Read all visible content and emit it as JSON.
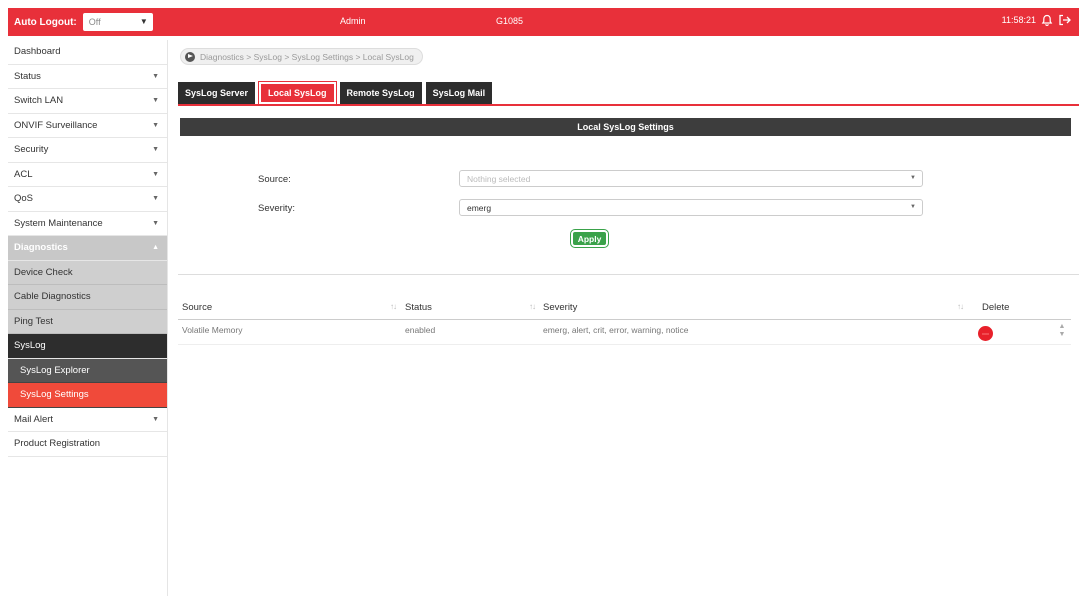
{
  "topbar": {
    "autologout_label": "Auto Logout:",
    "autologout_value": "Off",
    "user": "Admin",
    "model": "G1085",
    "time": "11:58:21"
  },
  "sidebar": {
    "items": [
      {
        "label": "Dashboard"
      },
      {
        "label": "Status"
      },
      {
        "label": "Switch LAN"
      },
      {
        "label": "ONVIF Surveillance"
      },
      {
        "label": "Security"
      },
      {
        "label": "ACL"
      },
      {
        "label": "QoS"
      },
      {
        "label": "System Maintenance"
      },
      {
        "label": "Diagnostics"
      },
      {
        "label": "Device Check"
      },
      {
        "label": "Cable Diagnostics"
      },
      {
        "label": "Ping Test"
      },
      {
        "label": "SysLog"
      },
      {
        "label": "SysLog Explorer"
      },
      {
        "label": "SysLog Settings"
      },
      {
        "label": "Mail Alert"
      },
      {
        "label": "Product Registration"
      }
    ]
  },
  "breadcrumb": "Diagnostics > SysLog > SysLog Settings > Local SysLog",
  "tabs": [
    {
      "label": "SysLog Server"
    },
    {
      "label": "Local SysLog"
    },
    {
      "label": "Remote SysLog"
    },
    {
      "label": "SysLog Mail"
    }
  ],
  "section_title": "Local SysLog Settings",
  "form": {
    "source_label": "Source:",
    "source_placeholder": "Nothing selected",
    "severity_label": "Severity:",
    "severity_value": "emerg",
    "apply_label": "Apply"
  },
  "table": {
    "headers": {
      "source": "Source",
      "status": "Status",
      "severity": "Severity",
      "delete": "Delete"
    },
    "rows": [
      {
        "source": "Volatile Memory",
        "status": "enabled",
        "severity": "emerg, alert, crit, error, warning, notice"
      }
    ]
  },
  "colors": {
    "accent": "#e8303a",
    "dark": "#2d2d2d",
    "apply": "#3aa24a"
  }
}
